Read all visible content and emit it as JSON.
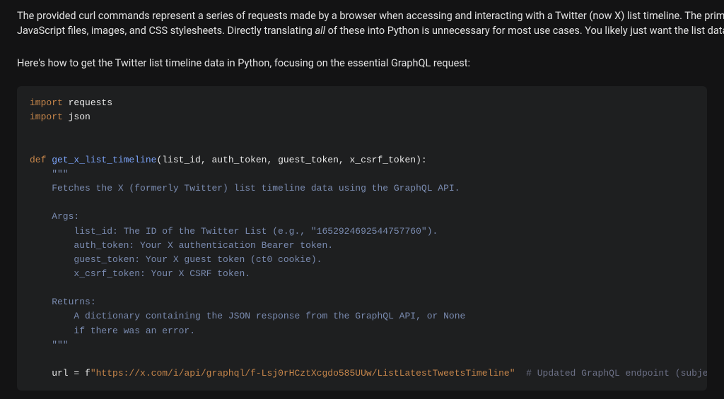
{
  "intro": {
    "line1_a": "The provided curl commands represent a series of requests made by a browser when accessing and interacting with a Twitter (now X) list timeline. The primary request fo",
    "line2_a": "JavaScript files, images, and CSS stylesheets. Directly translating ",
    "line2_em": "all",
    "line2_b": " of these into Python is unnecessary for most use cases. You likely just want the list data."
  },
  "subtext": "Here's how to get the Twitter list timeline data in Python, focusing on the essential GraphQL request:",
  "code": {
    "kw_import1": "import",
    "mod_requests": " requests",
    "kw_import2": "import",
    "mod_json": " json",
    "kw_def": "def",
    "fn_name": " get_x_list_timeline",
    "params": "(list_id, auth_token, guest_token, x_csrf_token):",
    "doc_open": "    \"\"\"",
    "doc_l1": "    Fetches the X (formerly Twitter) list timeline data using the GraphQL API.",
    "doc_args": "    Args:",
    "doc_a1": "        list_id: The ID of the Twitter List (e.g., \"1652924692544757760\").",
    "doc_a2": "        auth_token: Your X authentication Bearer token.",
    "doc_a3": "        guest_token: Your X guest token (ct0 cookie).",
    "doc_a4": "        x_csrf_token: Your X CSRF token.",
    "doc_ret": "    Returns:",
    "doc_r1": "        A dictionary containing the JSON response from the GraphQL API, or None",
    "doc_r2": "        if there was an error.",
    "doc_close": "    \"\"\"",
    "url_assign_a": "    url = f",
    "url_str": "\"https://x.com/i/api/graphql/f-Lsj0rHCztXcgdo585UUw/ListLatestTweetsTimeline\"",
    "url_comment": "  # Updated GraphQL endpoint (subject to change, verify if needed)"
  }
}
